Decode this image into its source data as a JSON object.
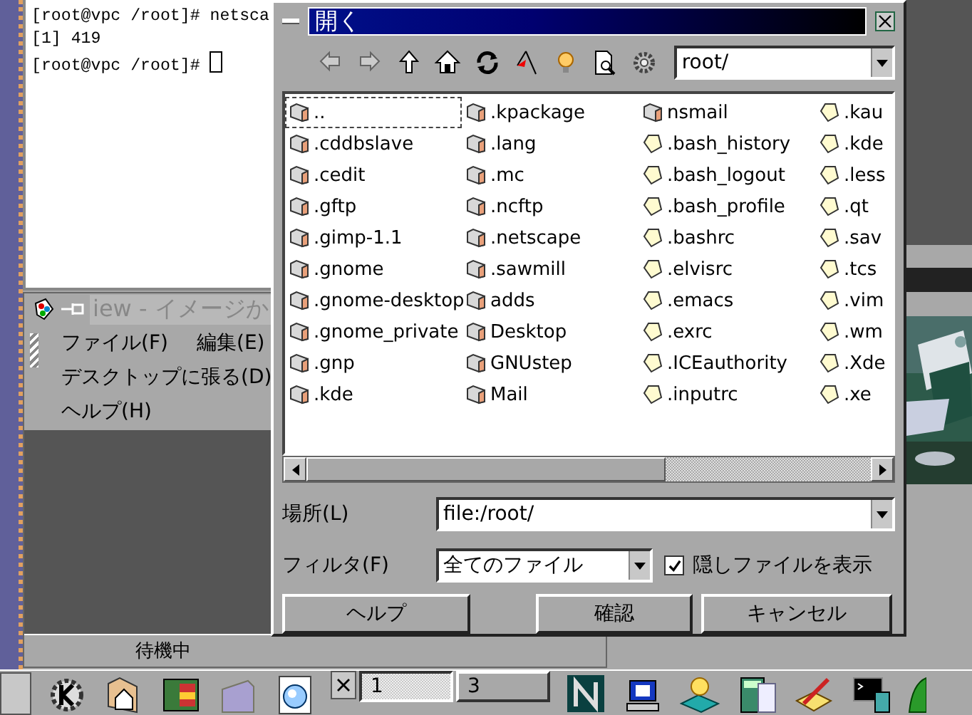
{
  "terminal": {
    "lines": [
      "[root@vpc /root]# netsca",
      "[1] 419",
      "[root@vpc /root]#"
    ]
  },
  "viewer": {
    "title": "iew - イメージか",
    "menus": [
      [
        "ファイル(F)",
        "編集(E)"
      ],
      [
        "デスクトップに張る(D)"
      ],
      [
        "ヘルプ(H)"
      ]
    ],
    "status": "待機中"
  },
  "dialog": {
    "title": "開く",
    "toolbar": [
      {
        "kind": "back",
        "disabled": true
      },
      {
        "kind": "forward",
        "disabled": true
      },
      {
        "kind": "up",
        "disabled": false
      },
      {
        "kind": "home",
        "disabled": false
      },
      {
        "kind": "reload",
        "disabled": false
      },
      {
        "kind": "bookmark",
        "disabled": false
      },
      {
        "kind": "hint",
        "disabled": false
      },
      {
        "kind": "preview",
        "disabled": false
      },
      {
        "kind": "settings",
        "disabled": false
      }
    ],
    "path": "root/",
    "columns": [
      [
        {
          "name": "..",
          "kind": "folder",
          "selected": true
        },
        {
          "name": ".cddbslave",
          "kind": "folder",
          "selected": false
        },
        {
          "name": ".cedit",
          "kind": "folder",
          "selected": false
        },
        {
          "name": ".gftp",
          "kind": "folder",
          "selected": false
        },
        {
          "name": ".gimp-1.1",
          "kind": "folder",
          "selected": false
        },
        {
          "name": ".gnome",
          "kind": "folder",
          "selected": false
        },
        {
          "name": ".gnome-desktop",
          "kind": "folder",
          "selected": false
        },
        {
          "name": ".gnome_private",
          "kind": "folder",
          "selected": false
        },
        {
          "name": ".gnp",
          "kind": "folder",
          "selected": false
        },
        {
          "name": ".kde",
          "kind": "folder",
          "selected": false
        }
      ],
      [
        {
          "name": ".kpackage",
          "kind": "folder",
          "selected": false
        },
        {
          "name": ".lang",
          "kind": "folder",
          "selected": false
        },
        {
          "name": ".mc",
          "kind": "folder",
          "selected": false
        },
        {
          "name": ".ncftp",
          "kind": "folder",
          "selected": false
        },
        {
          "name": ".netscape",
          "kind": "folder",
          "selected": false
        },
        {
          "name": ".sawmill",
          "kind": "folder",
          "selected": false
        },
        {
          "name": "adds",
          "kind": "folder",
          "selected": false
        },
        {
          "name": "Desktop",
          "kind": "folder",
          "selected": false
        },
        {
          "name": "GNUstep",
          "kind": "folder",
          "selected": false
        },
        {
          "name": "Mail",
          "kind": "folder",
          "selected": false
        }
      ],
      [
        {
          "name": "nsmail",
          "kind": "folder",
          "selected": false
        },
        {
          "name": ".bash_history",
          "kind": "file",
          "selected": false
        },
        {
          "name": ".bash_logout",
          "kind": "file",
          "selected": false
        },
        {
          "name": ".bash_profile",
          "kind": "file",
          "selected": false
        },
        {
          "name": ".bashrc",
          "kind": "file",
          "selected": false
        },
        {
          "name": ".elvisrc",
          "kind": "file",
          "selected": false
        },
        {
          "name": ".emacs",
          "kind": "file",
          "selected": false
        },
        {
          "name": ".exrc",
          "kind": "file",
          "selected": false
        },
        {
          "name": ".ICEauthority",
          "kind": "file",
          "selected": false
        },
        {
          "name": ".inputrc",
          "kind": "file",
          "selected": false
        }
      ],
      [
        {
          "name": ".kau",
          "kind": "file",
          "selected": false
        },
        {
          "name": ".kde",
          "kind": "file",
          "selected": false
        },
        {
          "name": ".less",
          "kind": "file",
          "selected": false
        },
        {
          "name": ".qt",
          "kind": "file",
          "selected": false
        },
        {
          "name": ".sav",
          "kind": "file",
          "selected": false
        },
        {
          "name": ".tcs",
          "kind": "file",
          "selected": false
        },
        {
          "name": ".vim",
          "kind": "file",
          "selected": false
        },
        {
          "name": ".wm",
          "kind": "file",
          "selected": false
        },
        {
          "name": ".Xde",
          "kind": "file",
          "selected": false
        },
        {
          "name": ".xe",
          "kind": "file",
          "selected": false
        }
      ]
    ],
    "location_label": "場所(L)",
    "location": "file:/root/",
    "filter_label": "フィルタ(F)",
    "filter": "全てのファイル",
    "show_hidden": {
      "label": "隠しファイルを表示",
      "checked": true
    },
    "buttons": [
      "ヘルプ",
      "確認",
      "キャンセル"
    ]
  },
  "taskbar": {
    "pager": [
      {
        "label": "1",
        "selected": true
      },
      {
        "label": "3",
        "selected": false
      }
    ]
  }
}
